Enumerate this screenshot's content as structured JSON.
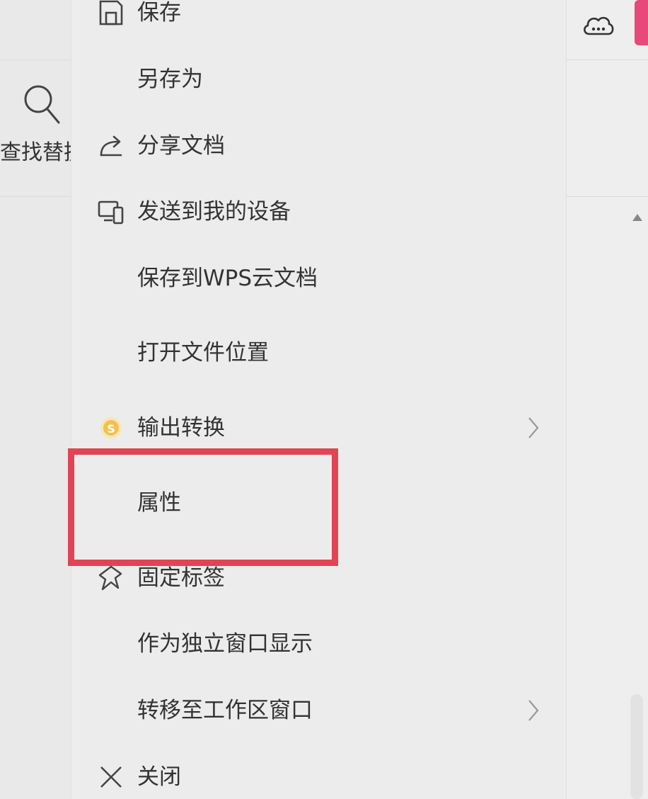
{
  "ribbon": {
    "find_replace_label": "查找替换"
  },
  "menu": {
    "items": [
      {
        "id": "save",
        "label": "保存",
        "icon": "save-icon"
      },
      {
        "id": "save-as",
        "label": "另存为",
        "icon": ""
      },
      {
        "id": "share",
        "label": "分享文档",
        "icon": "share-icon"
      },
      {
        "id": "send-device",
        "label": "发送到我的设备",
        "icon": "device-icon"
      },
      {
        "id": "save-cloud",
        "label": "保存到WPS云文档",
        "icon": ""
      },
      {
        "id": "open-location",
        "label": "打开文件位置",
        "icon": ""
      },
      {
        "id": "export",
        "label": "输出转换",
        "icon": "coin-icon",
        "submenu": true
      },
      {
        "id": "properties",
        "label": "属性",
        "icon": "",
        "highlighted": true
      },
      {
        "id": "pin-tab",
        "label": "固定标签",
        "icon": "pin-icon"
      },
      {
        "id": "independent-window",
        "label": "作为独立窗口显示",
        "icon": ""
      },
      {
        "id": "move-workspace",
        "label": "转移至工作区窗口",
        "icon": "",
        "submenu": true
      },
      {
        "id": "close",
        "label": "关闭",
        "icon": "close-icon"
      }
    ]
  },
  "colors": {
    "highlight": "#e04455",
    "text": "#333333",
    "badge": "#e8497a",
    "coin": "#f2c14e"
  }
}
